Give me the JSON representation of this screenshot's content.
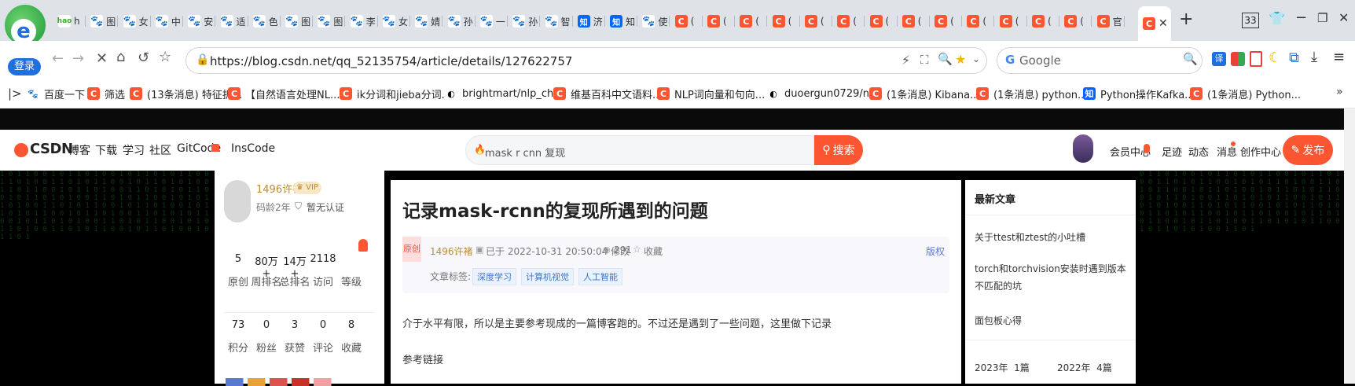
{
  "browser": {
    "login_label": "登录",
    "url": "https://blog.csdn.net/qq_52135754/article/details/127622757",
    "search_placeholder": "Google",
    "tab_count": "33",
    "active_tab_title": "记",
    "tabs": [
      {
        "icon": "hao",
        "title": "h"
      },
      {
        "icon": "baidu",
        "title": "图"
      },
      {
        "icon": "baidu",
        "title": "女"
      },
      {
        "icon": "baidu",
        "title": "中"
      },
      {
        "icon": "baidu",
        "title": "安"
      },
      {
        "icon": "baidu",
        "title": "适"
      },
      {
        "icon": "baidu",
        "title": "色"
      },
      {
        "icon": "baidu",
        "title": "图"
      },
      {
        "icon": "baidu",
        "title": "图"
      },
      {
        "icon": "baidu",
        "title": "李"
      },
      {
        "icon": "baidu",
        "title": "女"
      },
      {
        "icon": "baidu",
        "title": "婧"
      },
      {
        "icon": "baidu",
        "title": "孙"
      },
      {
        "icon": "baidu",
        "title": "一"
      },
      {
        "icon": "baidu",
        "title": "孙"
      },
      {
        "icon": "baidu",
        "title": "智"
      },
      {
        "icon": "zhi",
        "title": "济"
      },
      {
        "icon": "zhi",
        "title": "知"
      },
      {
        "icon": "baidu",
        "title": "使"
      },
      {
        "icon": "c",
        "title": "("
      },
      {
        "icon": "c",
        "title": "("
      },
      {
        "icon": "c",
        "title": "("
      },
      {
        "icon": "c",
        "title": "("
      },
      {
        "icon": "c",
        "title": "("
      },
      {
        "icon": "c",
        "title": "("
      },
      {
        "icon": "c",
        "title": "("
      },
      {
        "icon": "c",
        "title": "("
      },
      {
        "icon": "c",
        "title": "("
      },
      {
        "icon": "c",
        "title": "("
      },
      {
        "icon": "c",
        "title": "("
      },
      {
        "icon": "c",
        "title": "("
      },
      {
        "icon": "c",
        "title": "("
      },
      {
        "icon": "c",
        "title": "官"
      }
    ]
  },
  "bookmarks": [
    {
      "icon": "baidu",
      "label": "百度一下"
    },
    {
      "icon": "c",
      "label": "筛选"
    },
    {
      "icon": "c",
      "label": "(13条消息) 特征折..."
    },
    {
      "icon": "c",
      "label": "【自然语言处理NL..."
    },
    {
      "icon": "c",
      "label": "ik分词和jieba分词..."
    },
    {
      "icon": "gh",
      "label": "brightmart/nlp_ch..."
    },
    {
      "icon": "c",
      "label": "维基百科中文语料..."
    },
    {
      "icon": "c",
      "label": "NLP词向量和句向..."
    },
    {
      "icon": "gh",
      "label": "duoergun0729/nl..."
    },
    {
      "icon": "c",
      "label": "(1条消息) Kibana..."
    },
    {
      "icon": "c",
      "label": "(1条消息) python..."
    },
    {
      "icon": "zhi",
      "label": "Python操作Kafka..."
    },
    {
      "icon": "c",
      "label": "(1条消息) Python..."
    }
  ],
  "csdn": {
    "logo": "CSDN",
    "nav": [
      "博客",
      "下载",
      "学习",
      "社区",
      "GitCode",
      "InsCode"
    ],
    "search_value": "mask r cnn 复现",
    "search_button": "搜索",
    "right_nav": [
      "会员中心",
      "足迹",
      "动态",
      "消息",
      "创作中心"
    ],
    "publish_button": "发布"
  },
  "author": {
    "name": "1496许褚",
    "vip": "VIP",
    "code_age": "码龄2年",
    "cert": "暂无认证",
    "stats_row1": [
      {
        "value": "5",
        "label": "原创"
      },
      {
        "value": "80万+",
        "label": "周排名"
      },
      {
        "value": "14万+",
        "label": "总排名"
      },
      {
        "value": "2118",
        "label": "访问"
      },
      {
        "value": "",
        "label": "等级"
      }
    ],
    "stats_row2": [
      {
        "value": "73",
        "label": "积分"
      },
      {
        "value": "0",
        "label": "粉丝"
      },
      {
        "value": "3",
        "label": "获赞"
      },
      {
        "value": "0",
        "label": "评论"
      },
      {
        "value": "8",
        "label": "收藏"
      }
    ]
  },
  "article": {
    "title": "记录mask-rcnn的复现所遇到的问题",
    "badge": "原创",
    "author": "1496许褚",
    "date": "已于 2022-10-31 20:50:04 修改",
    "views": "291",
    "collect": "收藏",
    "copyright": "版权",
    "tags_label": "文章标签:",
    "tags": [
      "深度学习",
      "计算机视觉",
      "人工智能"
    ],
    "para1": "介于水平有限，所以是主要参考现成的一篇博客跑的。不过还是遇到了一些问题，这里做下记录",
    "para2": "参考链接"
  },
  "sidebar": {
    "title": "最新文章",
    "items": [
      "关于ttest和ztest的小吐槽",
      "torch和torchvision安装时遇到版本不匹配的坑",
      "面包板心得"
    ],
    "archive": [
      "2023年  1篇",
      "2022年  4篇"
    ]
  },
  "colors": {
    "accent": "#fc5531",
    "gold": "#ba8b36",
    "blue": "#3d76c5"
  }
}
